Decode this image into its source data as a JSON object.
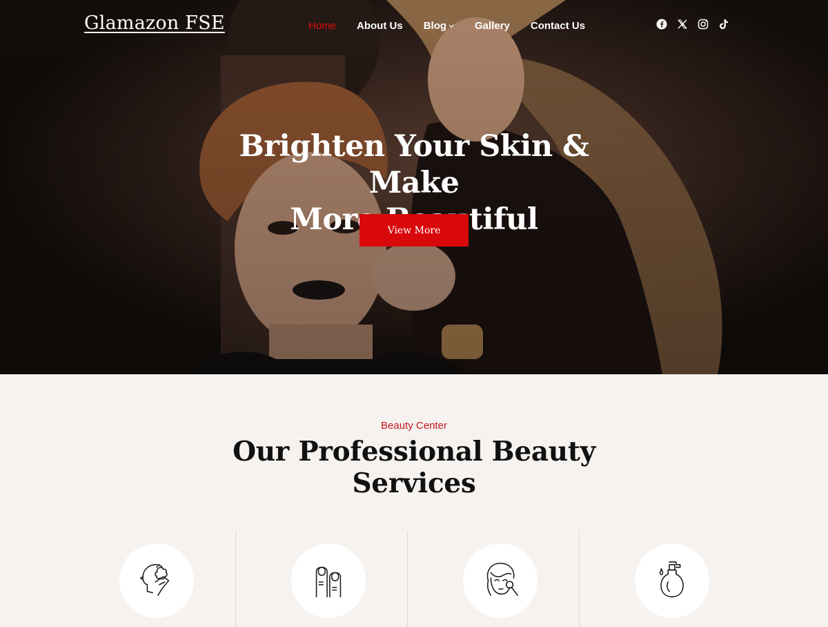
{
  "header": {
    "logo": "Glamazon FSE",
    "nav": [
      {
        "label": "Home",
        "active": true
      },
      {
        "label": "About Us",
        "active": false
      },
      {
        "label": "Blog",
        "active": false,
        "has_dropdown": true
      },
      {
        "label": "Gallery",
        "active": false
      },
      {
        "label": "Contact Us",
        "active": false
      }
    ],
    "socials": [
      "facebook-icon",
      "x-icon",
      "instagram-icon",
      "tiktok-icon"
    ]
  },
  "hero": {
    "title_line1": "Brighten Your Skin & Make",
    "title_line2": "More Beautiful",
    "button": "View More"
  },
  "services": {
    "eyebrow": "Beauty Center",
    "title_line1": "Our Professional Beauty",
    "title_line2": "Services",
    "icons": [
      "hair-care-icon",
      "nail-care-icon",
      "makeup-icon",
      "cosmetics-bottle-icon"
    ]
  },
  "colors": {
    "accent": "#d8080b",
    "active_nav": "#e00b0b",
    "eyebrow": "#c8161d",
    "section_bg": "#f5f2ef"
  }
}
